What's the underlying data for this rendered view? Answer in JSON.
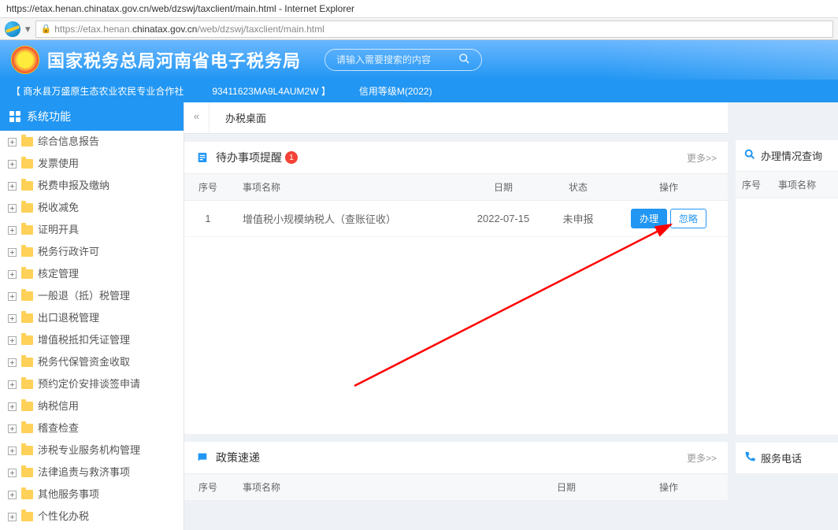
{
  "browser": {
    "title_url": "https://etax.henan.chinatax.gov.cn/web/dzswj/taxclient/main.html",
    "title_suffix": " - Internet Explorer",
    "addr_prefix": "https://",
    "addr_host": "etax.henan.",
    "addr_bold": "chinatax.gov.cn",
    "addr_path": "/web/dzswj/taxclient/main.html"
  },
  "header": {
    "site_title": "国家税务总局河南省电子税务局",
    "search_placeholder": "请输入需要搜索的内容"
  },
  "subheader": {
    "company": "【 商水县万盛原生态农业农民专业合作社",
    "tax_id": "93411623MA9L4AUM2W 】",
    "credit": "信用等级M(2022)"
  },
  "sidebar": {
    "head": "系统功能",
    "items": [
      "综合信息报告",
      "发票使用",
      "税费申报及缴纳",
      "税收减免",
      "证明开具",
      "税务行政许可",
      "核定管理",
      "一般退（抵）税管理",
      "出口退税管理",
      "增值税抵扣凭证管理",
      "税务代保管资金收取",
      "预约定价安排谈签申请",
      "纳税信用",
      "稽查检查",
      "涉税专业服务机构管理",
      "法律追责与救济事项",
      "其他服务事项",
      "个性化办税"
    ]
  },
  "tabs": {
    "main": "办税桌面",
    "collapse": "«"
  },
  "todo_card": {
    "title": "待办事项提醒",
    "badge": "1",
    "more": "更多>>",
    "cols": {
      "seq": "序号",
      "name": "事项名称",
      "date": "日期",
      "status": "状态",
      "action": "操作"
    },
    "rows": [
      {
        "seq": "1",
        "name": "增值税小规模纳税人（查账征收）",
        "date": "2022-07-15",
        "status": "未申报",
        "action1": "办理",
        "action2": "忽略"
      }
    ]
  },
  "news_card": {
    "title": "政策速递",
    "more": "更多>>",
    "cols": {
      "seq": "序号",
      "name": "事项名称",
      "date": "日期",
      "action": "操作"
    }
  },
  "side_panel1": {
    "title": "办理情况查询",
    "cols": {
      "seq": "序号",
      "name": "事项名称"
    }
  },
  "side_panel2": {
    "title": "服务电话"
  },
  "colors": {
    "primary": "#2196f3",
    "danger": "#f44336"
  }
}
